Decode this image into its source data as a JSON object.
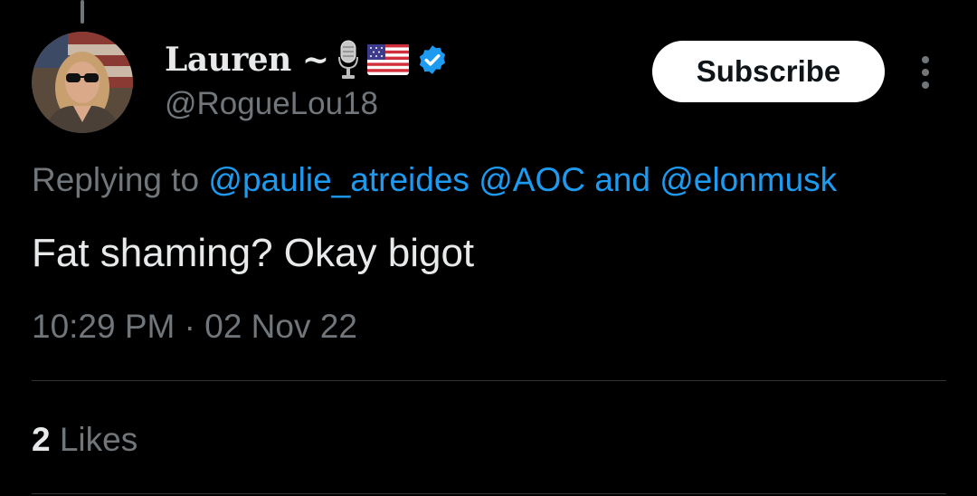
{
  "tweet": {
    "author": {
      "display_name": "Lauren ~",
      "name_emojis": [
        "microphone-icon",
        "us-flag-icon"
      ],
      "verified": true,
      "handle": "@RogueLou18"
    },
    "subscribe_label": "Subscribe",
    "more_icon": "more-vertical-icon",
    "reply": {
      "prefix": "Replying to",
      "mention1": "@paulie_atreides",
      "mention2": "@AOC",
      "conjunction": "and",
      "mention3": "@elonmusk"
    },
    "text": "Fat shaming? Okay bigot",
    "timestamp": "10:29 PM · 02 Nov 22",
    "likes": {
      "count": "2",
      "label": "Likes"
    }
  },
  "colors": {
    "background": "#000000",
    "primary_text": "#e7e9ea",
    "secondary_text": "#71767b",
    "link": "#1d9bf0",
    "divider": "#2f3336",
    "button_bg": "#ffffff",
    "button_text": "#0f1419",
    "verified_badge": "#1d9bf0"
  }
}
